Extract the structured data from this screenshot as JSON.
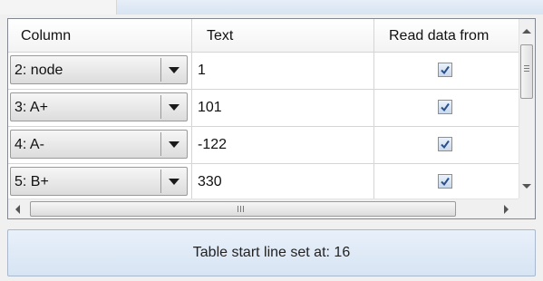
{
  "grid": {
    "headers": [
      "Column",
      "Text",
      "Read data from"
    ],
    "rows": [
      {
        "column": "2: node",
        "text": "1",
        "checked": true
      },
      {
        "column": "3: A+",
        "text": "101",
        "checked": true
      },
      {
        "column": "4: A-",
        "text": "-122",
        "checked": true
      },
      {
        "column": "5: B+",
        "text": "330",
        "checked": true
      }
    ]
  },
  "scrollbar": {
    "vertical_position": 0.1,
    "horizontal_position": 0.05
  },
  "status": {
    "text": "Table start line set at: 16"
  },
  "colors": {
    "status_background": "#dde8f6",
    "check_mark": "#2b4f8a"
  }
}
